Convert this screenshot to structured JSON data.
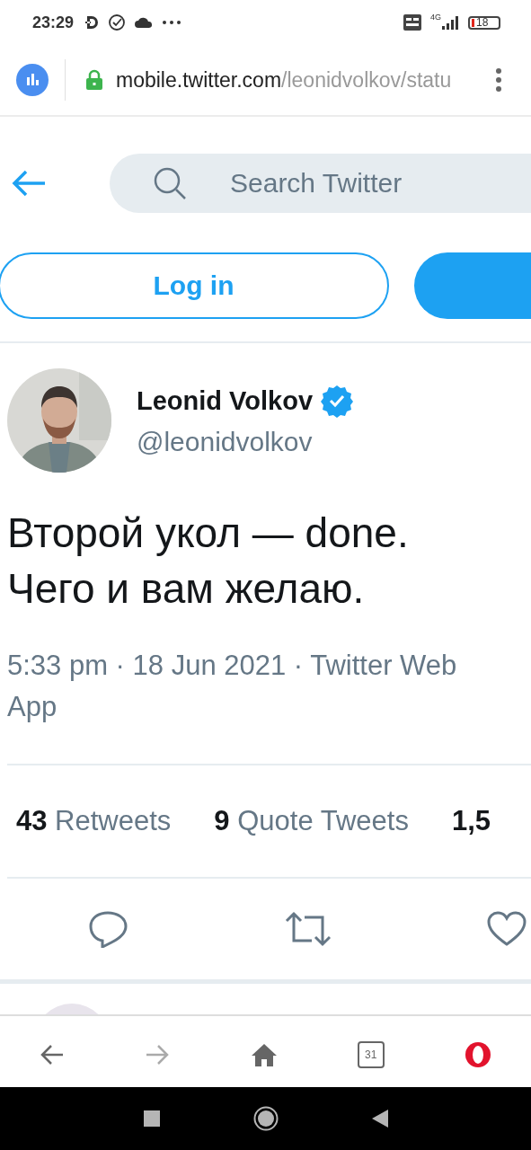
{
  "status_bar": {
    "time": "23:29",
    "network": "4G",
    "battery": "18"
  },
  "address_bar": {
    "host": "mobile.twitter.com",
    "path": "/leonidvolkov/statu"
  },
  "search": {
    "placeholder": "Search Twitter"
  },
  "login_button": "Log in",
  "tweet": {
    "name": "Leonid Volkov",
    "verified": true,
    "handle": "@leonidvolkov",
    "text": "Второй укол — done. Чего и вам желаю.",
    "meta": "5:33 pm · 18 Jun 2021 · Twitter Web App"
  },
  "stats": [
    {
      "count": "43",
      "label": "Retweets"
    },
    {
      "count": "9",
      "label": "Quote Tweets"
    },
    {
      "count": "1,5"
    }
  ],
  "actions": [
    {
      "kind": "reply"
    },
    {
      "kind": "retweet"
    },
    {
      "kind": "like"
    }
  ],
  "browser_nav": [
    {
      "kind": "back",
      "disabled": false
    },
    {
      "kind": "forward",
      "disabled": true
    },
    {
      "kind": "home"
    },
    {
      "kind": "tabs",
      "count": "31"
    },
    {
      "kind": "opera"
    }
  ]
}
